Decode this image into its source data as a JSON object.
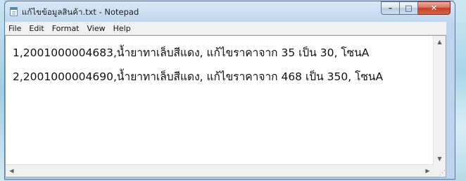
{
  "window": {
    "title": "แก้ไขข้อมูลสินค้า.txt - Notepad",
    "caption": {
      "minimize": "–",
      "maximize": "□",
      "close": "✕"
    }
  },
  "menu": {
    "file": "File",
    "edit": "Edit",
    "format": "Format",
    "view": "View",
    "help": "Help"
  },
  "document": {
    "lines": [
      "1,2001000004683,น้ำยาทาเล็บสีแดง, แก้ไขราคาจาก 35 เป็น 30, โซนA",
      "2,2001000004690,น้ำยาทาเล็บสีแดง, แก้ไขราคาจาก 468 เป็น 350, โซนA"
    ]
  },
  "icons": {
    "app": "notepad-icon",
    "scroll_up": "▲",
    "scroll_down": "▼",
    "scroll_left": "◀",
    "scroll_right": "▶",
    "grip": "⋰"
  }
}
